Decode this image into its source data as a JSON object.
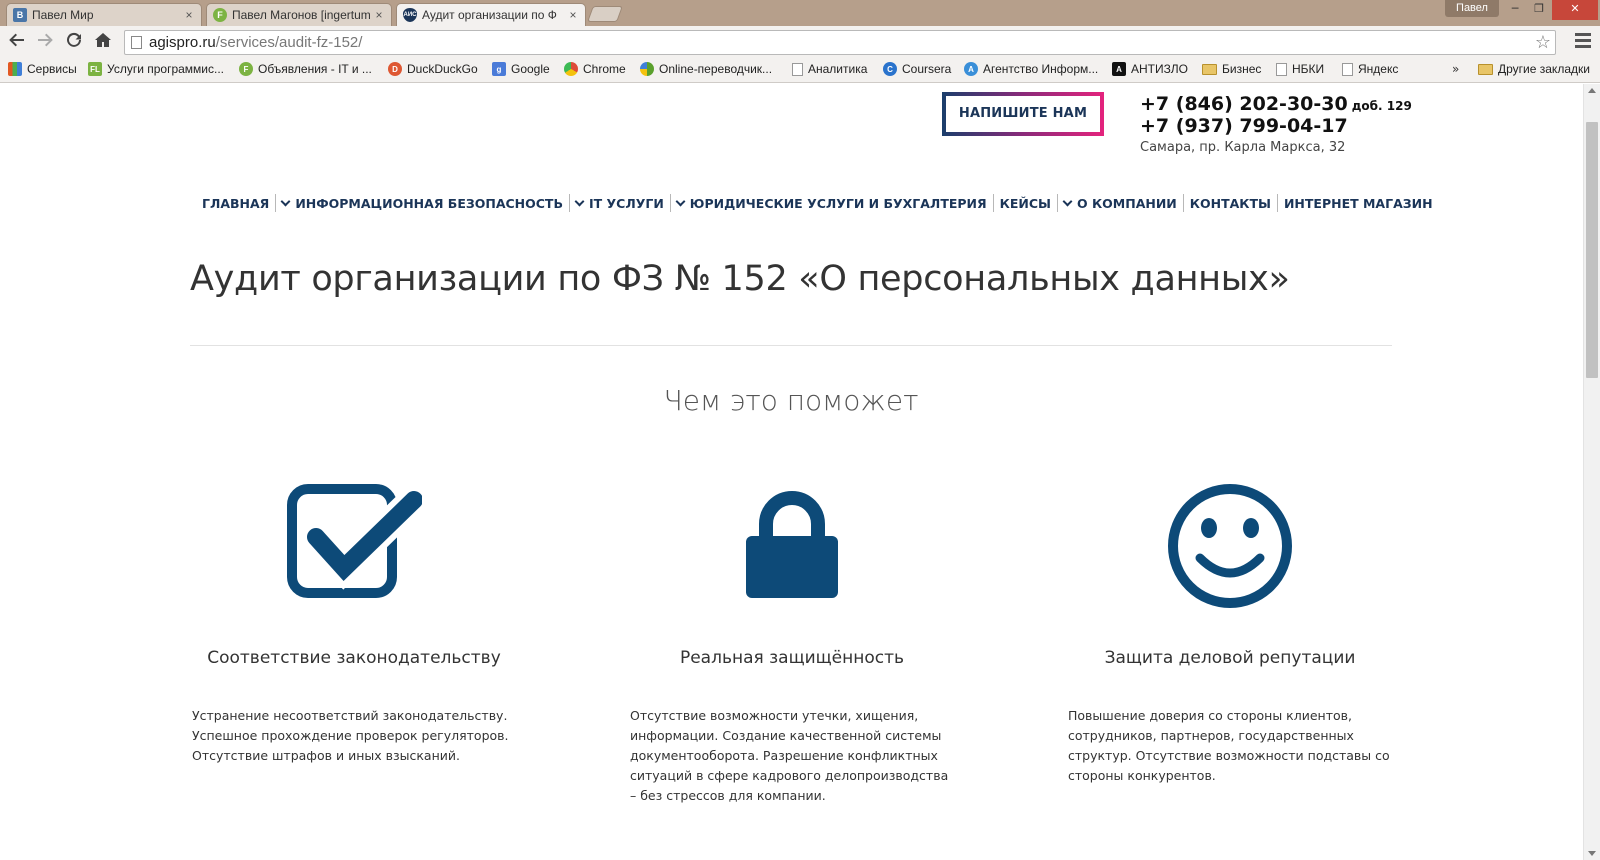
{
  "browser": {
    "tabs": [
      {
        "title": "Павел Мир",
        "favicon_text": "B",
        "favicon_color": "#4a76a8",
        "active": false
      },
      {
        "title": "Павел Магонов [ingertum",
        "favicon_text": "F",
        "favicon_color": "#7cb342",
        "active": false
      },
      {
        "title": "Аудит организации по Ф",
        "favicon_text": "АИС",
        "favicon_color": "#1b3558",
        "active": true
      }
    ],
    "tab_close_glyph": "×",
    "profile_name": "Павел",
    "window_buttons": {
      "minimize": "─",
      "restore": "❐",
      "close": "✕"
    },
    "url_host": "agispro.ru",
    "url_path": "/services/audit-fz-152/",
    "bookmarks": [
      {
        "label": "Сервисы",
        "icon": "apps-icon",
        "color": "#e25822"
      },
      {
        "label": "Услуги программис...",
        "icon": "fl-icon",
        "color": "#7cb342",
        "text": "FL"
      },
      {
        "label": "Объявления - IT и ...",
        "icon": "f-icon",
        "color": "#7cb342",
        "text": "F"
      },
      {
        "label": "DuckDuckGo",
        "icon": "duckduckgo-icon",
        "color": "#de5833",
        "text": "D"
      },
      {
        "label": "Google",
        "icon": "google-icon",
        "color": "#4a7bd8",
        "text": "g"
      },
      {
        "label": "Chrome",
        "icon": "chrome-icon",
        "color": "#dd4b39",
        "text": "C"
      },
      {
        "label": "Online-переводчик...",
        "icon": "translate-icon",
        "color": "#5aa02c",
        "text": "T"
      },
      {
        "label": "Аналитика",
        "icon": "page-icon",
        "color": "#ffffff"
      },
      {
        "label": "Coursera",
        "icon": "coursera-icon",
        "color": "#2a73cc",
        "text": "C"
      },
      {
        "label": "Агентство Информ...",
        "icon": "agency-icon",
        "color": "#3a8fd8",
        "text": "A"
      },
      {
        "label": "АНТИЗЛО",
        "icon": "antizlo-icon",
        "color": "#111111",
        "text": "A"
      },
      {
        "label": "Бизнес",
        "icon": "folder-icon",
        "color": "#e8c567"
      },
      {
        "label": "НБКИ",
        "icon": "page-icon",
        "color": "#ffffff"
      },
      {
        "label": "Яндекс",
        "icon": "page-icon",
        "color": "#ffffff"
      }
    ],
    "bookmarks_more": "»",
    "other_bookmarks": "Другие закладки"
  },
  "header": {
    "write_button": "НАПИШИТЕ НАМ",
    "phone1": "+7 (846) 202-30-30",
    "phone1_ext": "доб. 129",
    "phone2": "+7 (937) 799-04-17",
    "address": "Самара, пр. Карла Маркса, 32"
  },
  "nav": [
    {
      "label": "ГЛАВНАЯ",
      "dropdown": false
    },
    {
      "label": "ИНФОРМАЦИОННАЯ БЕЗОПАСНОСТЬ",
      "dropdown": true
    },
    {
      "label": "IT УСЛУГИ",
      "dropdown": true
    },
    {
      "label": "ЮРИДИЧЕСКИЕ УСЛУГИ И БУХГАЛТЕРИЯ",
      "dropdown": true
    },
    {
      "label": "КЕЙСЫ",
      "dropdown": false
    },
    {
      "label": "О КОМПАНИИ",
      "dropdown": true
    },
    {
      "label": "КОНТАКТЫ",
      "dropdown": false
    },
    {
      "label": "ИНТЕРНЕТ МАГАЗИН",
      "dropdown": false
    }
  ],
  "main": {
    "title": "Аудит организации по ФЗ № 152 «О персональных данных»",
    "section_title": "Чем это поможет",
    "features": [
      {
        "icon": "checkbox-icon",
        "title": "Соответствие законодательству",
        "text": [
          "Устранение несоответствий законодательству.",
          "Успешное прохождение проверок регуляторов.",
          "Отсутствие штрафов и иных взысканий."
        ]
      },
      {
        "icon": "lock-icon",
        "title": "Реальная защищённость",
        "text": [
          "Отсутствие возможности утечки, хищения,",
          "информации. Создание качественной системы",
          "документооборота. Разрешение конфликтных",
          "ситуаций в сфере кадрового делопроизводства",
          "– без стрессов для компании."
        ]
      },
      {
        "icon": "smiley-icon",
        "title": "Защита деловой репутации",
        "text": [
          "Повышение доверия со стороны клиентов,",
          "сотрудников, партнеров, государственных",
          "структур. Отсутствие возможности подставы со",
          "стороны конкурентов."
        ]
      }
    ]
  },
  "colors": {
    "brand": "#1b3558",
    "icon": "#0d4a78",
    "accent": "#e4237d"
  }
}
